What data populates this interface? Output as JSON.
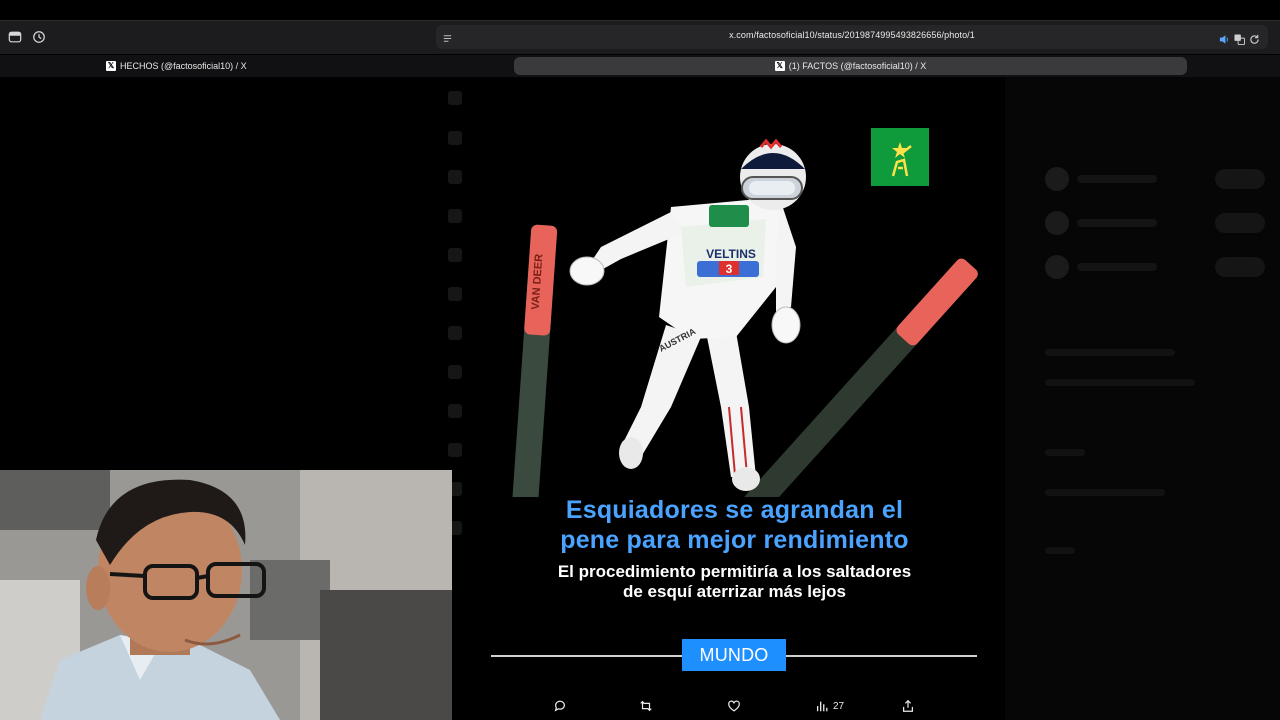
{
  "browser": {
    "url": "x.com/factosoficial10/status/2019874995493826656/photo/1",
    "tabs": [
      {
        "label": "HECHOS (@factosoficial10) / X",
        "active": false
      },
      {
        "label": "(1) FACTOS (@factosoficial10) / X",
        "active": true
      }
    ]
  },
  "photo": {
    "headline_line1": "Esquiadores se agrandan el",
    "headline_line2": "pene para mejor rendimiento",
    "subline_line1": "El procedimiento permitiría a los saltadores",
    "subline_line2": "de esquí aterrizar más lejos",
    "category": "MUNDO",
    "bib_number": "3",
    "bib_sponsor": "VELTINS",
    "ski_brand": "VAN DEER",
    "suit_text": "AUSTRIA"
  },
  "actions": {
    "views_count": "27"
  },
  "colors": {
    "headline": "#4aa3ff",
    "category_badge": "#1e8fff",
    "logo_badge": "#0f9a3c",
    "skis": "#e8645a"
  },
  "icons": [
    "sidebar-icon",
    "history-icon",
    "site-settings-icon",
    "speaker-icon",
    "translate-icon",
    "reload-icon",
    "x-logo-icon",
    "reply-icon",
    "repost-icon",
    "like-icon",
    "views-icon",
    "share-icon"
  ]
}
